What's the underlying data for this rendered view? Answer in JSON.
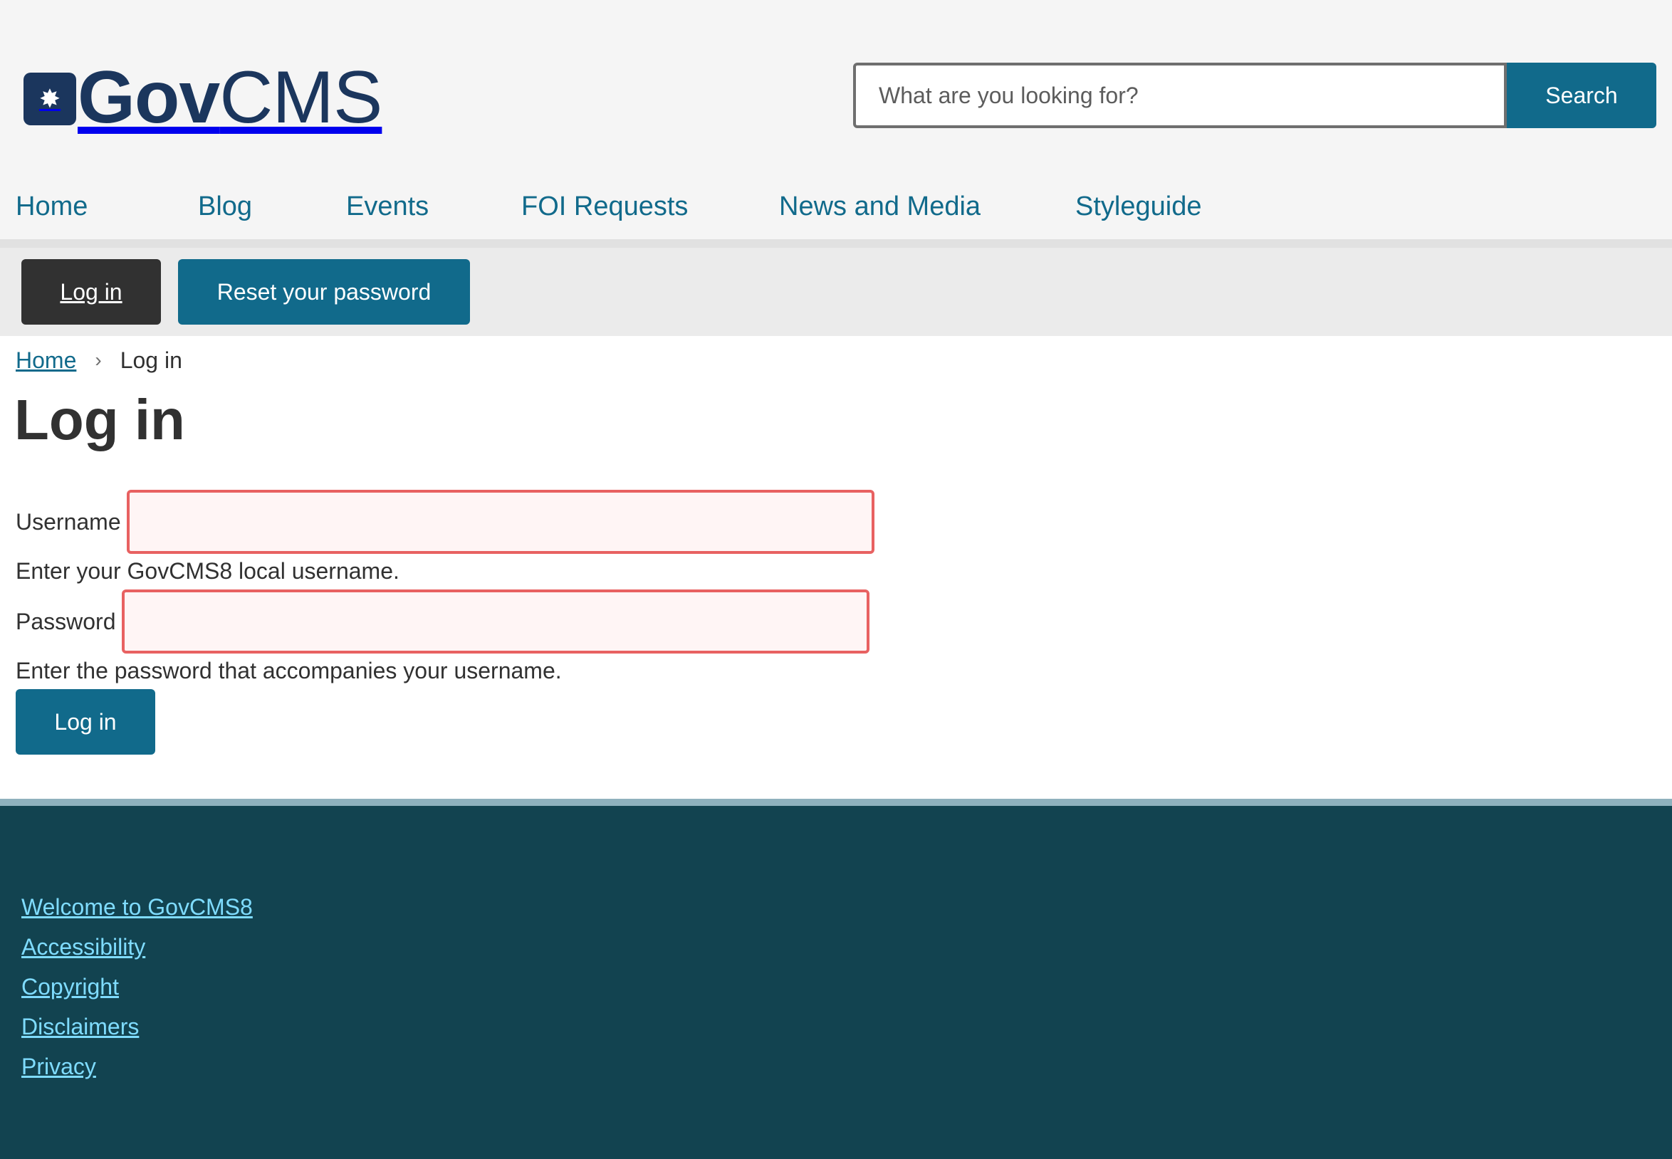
{
  "header": {
    "logo_icon": "star-icon",
    "logo_bold": "Gov",
    "logo_light": "CMS",
    "brand_color": "#1b365d"
  },
  "search": {
    "placeholder": "What are you looking for?",
    "value": "",
    "button_label": "Search"
  },
  "nav": {
    "items": [
      {
        "label": "Home"
      },
      {
        "label": "Blog"
      },
      {
        "label": "Events"
      },
      {
        "label": "FOI Requests"
      },
      {
        "label": "News and Media"
      },
      {
        "label": "Styleguide"
      }
    ]
  },
  "tabs": {
    "login_label": "Log in",
    "reset_label": "Reset your password"
  },
  "breadcrumb": {
    "home": "Home",
    "separator": "›",
    "current": "Log in"
  },
  "page": {
    "title": "Log in"
  },
  "form": {
    "username_label": "Username",
    "username_value": "",
    "username_description": "Enter your GovCMS8 local username.",
    "password_label": "Password",
    "password_value": "",
    "password_description": "Enter the password that accompanies your username.",
    "submit_label": "Log in",
    "error_border_color": "#e86161"
  },
  "footer": {
    "links": [
      {
        "label": "Welcome to GovCMS8"
      },
      {
        "label": "Accessibility"
      },
      {
        "label": "Copyright"
      },
      {
        "label": "Disclaimers"
      },
      {
        "label": "Privacy"
      }
    ]
  },
  "colors": {
    "accent": "#116a8b",
    "footer_bg": "#124350",
    "footer_link": "#7fdcff"
  }
}
